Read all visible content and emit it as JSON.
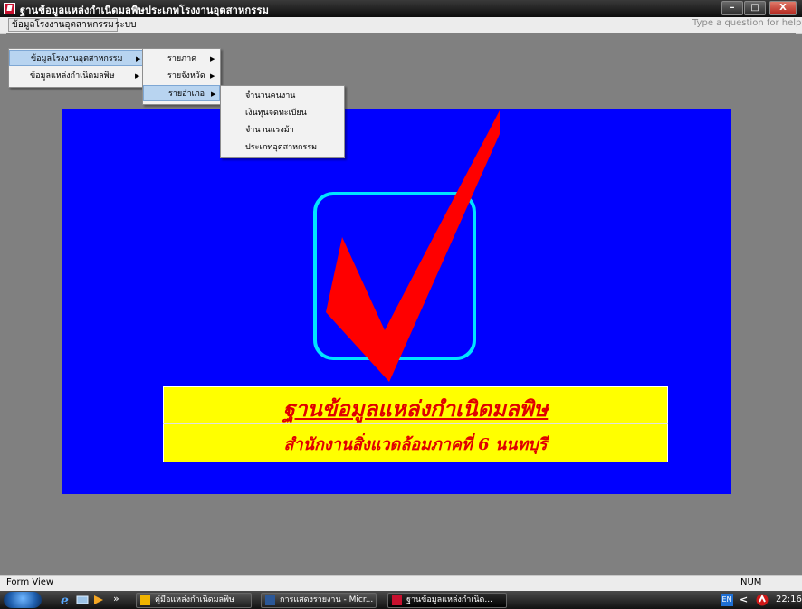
{
  "window": {
    "title": "ฐานข้อมูลแหล่งกำเนิดมลพิษประเภทโรงงานอุตสาหกรรม",
    "controls": {
      "minimize": "–",
      "maximize": "□",
      "close": "X"
    }
  },
  "menubar": {
    "items": [
      "ข้อมูลโรงงานอุตสาหกรรม",
      "ระบบ"
    ],
    "help_placeholder": "Type a question for help"
  },
  "menus": {
    "level1": [
      {
        "label": "ข้อมูลโรงงานอุตสาหกรรม",
        "has_submenu": true,
        "highlighted": true
      },
      {
        "label": "ข้อมูลแหล่งกำเนิดมลพิษ",
        "has_submenu": true,
        "highlighted": false
      }
    ],
    "level2": [
      {
        "label": "รายภาค",
        "has_submenu": true,
        "highlighted": false
      },
      {
        "label": "รายจังหวัด",
        "has_submenu": true,
        "highlighted": false
      },
      {
        "label": "รายอำเภอ",
        "has_submenu": true,
        "highlighted": true
      }
    ],
    "level3": [
      {
        "label": "จำนวนคนงาน"
      },
      {
        "label": "เงินทุนจดทะเบียน"
      },
      {
        "label": "จำนวนแรงม้า"
      },
      {
        "label": "ประเภทอุตสาหกรรม"
      }
    ],
    "arrow": "▶"
  },
  "form": {
    "banner_title": "ฐานข้อมูลแหล่งกำเนิดมลพิษ",
    "banner_subtitle": "สำนักงานสิ่งแวดล้อมภาคที่ 6 นนทบุรี"
  },
  "statusbar": {
    "left": "Form View",
    "right": "NUM"
  },
  "taskbar": {
    "chevron": "»",
    "tasks": [
      "คู่มือแหล่งกำเนิดมลพิษ",
      "การแสดงรายงาน - Micr...",
      "ฐานข้อมูลแหล่งกำเนิด..."
    ],
    "tray_lang": "EN",
    "tray_chevron": "<",
    "clock": "22:16"
  },
  "colors": {
    "panel": "#0000ff",
    "banner": "#ffff00",
    "banner_text": "#e00000",
    "checkmark": "#ff0000",
    "check_box": "#00e4ff"
  }
}
